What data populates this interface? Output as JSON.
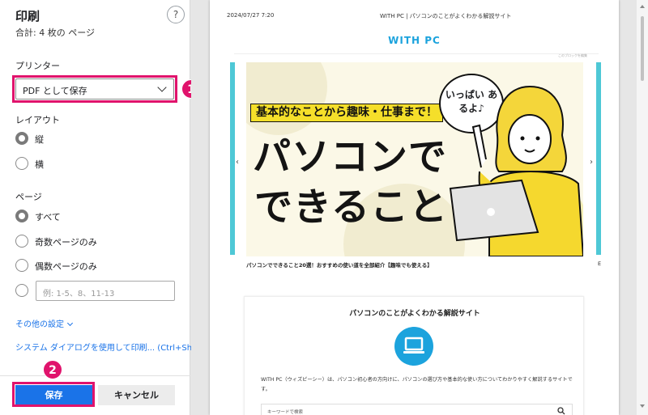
{
  "dialog": {
    "title": "印刷",
    "total": "合計: 4 枚の ページ",
    "help": "?"
  },
  "printer": {
    "label": "プリンター",
    "value": "PDF として保存"
  },
  "layout": {
    "label": "レイアウト",
    "options": [
      "縦",
      "横"
    ],
    "selected": "縦"
  },
  "pages": {
    "label": "ページ",
    "options": [
      "すべて",
      "奇数ページのみ",
      "偶数ページのみ"
    ],
    "selected": "すべて",
    "custom_placeholder": "例: 1-5、8、11-13"
  },
  "links": {
    "more_settings": "その他の設定",
    "system_dialog": "システム ダイアログを使用して印刷... (Ctrl+Shift+P)"
  },
  "buttons": {
    "save": "保存",
    "cancel": "キャンセル"
  },
  "annotations": {
    "badge1": "1",
    "badge2": "2",
    "highlight_color": "#e0136c"
  },
  "preview": {
    "date": "2024/07/27 7:20",
    "header": "WITH PC | パソコンのことがよくわかる解説サイト",
    "logo": "WITH PC",
    "small_note": "このブロックを編集",
    "hero": {
      "banner": "基本的なことから趣味・仕事まで！",
      "line1": "パソコンで",
      "line2": "できること",
      "bubble": "いっぱい あるよ♪"
    },
    "caption": "パソコンでできること20選！おすすめの使い道を全部紹介【趣味でも使える】",
    "caption_right": "E",
    "card": {
      "title": "パソコンのことがよくわかる解説サイト",
      "text": "WITH PC（ウィズピーシー）は、パソコン初心者の方向けに、パソコンの選び方や基本的な使い方についてわかりやすく解説するサイトです。",
      "search_placeholder": "キーワードで検索"
    }
  },
  "colors": {
    "accent": "#1a73e8",
    "brand": "#1ca3dd",
    "hero_yellow": "#f5df2a"
  }
}
